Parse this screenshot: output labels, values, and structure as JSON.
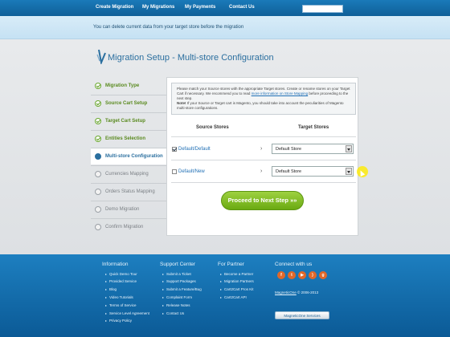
{
  "nav": {
    "items": [
      "Create Migration",
      "My Migrations",
      "My Payments",
      "Contact Us"
    ],
    "search_placeholder": ""
  },
  "notice": "You can delete current data from your target store before the migration",
  "page_title": "Migration Setup - Multi-store Configuration",
  "steps": [
    {
      "label": "Migration Type",
      "state": "done"
    },
    {
      "label": "Source Cart Setup",
      "state": "done"
    },
    {
      "label": "Target Cart Setup",
      "state": "done"
    },
    {
      "label": "Entities Selection",
      "state": "done"
    },
    {
      "label": "Multi-store Configuration",
      "state": "active"
    },
    {
      "label": "Currencies Mapping",
      "state": "pending"
    },
    {
      "label": "Orders Status Mapping",
      "state": "pending"
    },
    {
      "label": "Demo Migration",
      "state": "pending"
    },
    {
      "label": "Confirm Migration",
      "state": "pending"
    }
  ],
  "info": {
    "line1_pre": "Please match your Source stores with the appropriate Target stores. Create or rename stores on your Target Cart if necessary. We recommend you to read ",
    "link": "more information on Store Mapping",
    "line1_post": " before proceeding to the next step.",
    "note_label": "Note!",
    "note": " If your Source or Target cart is Magento, you should take into account the peculiarities of Magento multi-store configurations."
  },
  "table": {
    "source_header": "Source Stores",
    "target_header": "Target Stores",
    "rows": [
      {
        "source": "Default/Default",
        "checked": true,
        "target": "Default Store"
      },
      {
        "source": "Default/New",
        "checked": false,
        "target": "Default Store"
      }
    ]
  },
  "proceed_label": "Proceed to Next Step »»",
  "footer": {
    "information": {
      "title": "Information",
      "links": [
        "Quick Demo Tour",
        "Provided Service",
        "Blog",
        "Video Tutorials",
        "Terms of Service",
        "Service Level Agreement",
        "Privacy Policy"
      ]
    },
    "support": {
      "title": "Support Center",
      "links": [
        "Submit a Ticket",
        "Support Packages",
        "Submit a Feature/Bug",
        "Complaint Form",
        "Release Notes",
        "Contact Us"
      ]
    },
    "partner": {
      "title": "For Partner",
      "links": [
        "Become a Partner",
        "Migration Partners",
        "Cart2Cart Pros Kit",
        "Cart2Cart API"
      ]
    },
    "connect": {
      "title": "Connect with us",
      "icons": [
        "facebook-icon",
        "twitter-icon",
        "youtube-icon",
        "rss-icon",
        "google-plus-icon"
      ],
      "brand": "MagneticOne",
      "copyright": " © 2006-2013",
      "services_button": "MagneticOne Services"
    }
  },
  "colors": {
    "nav_blue": "#0f5f98",
    "accent_green": "#6aaa12",
    "done_green": "#5a8a1f",
    "title_blue": "#2b6f9f",
    "social_orange": "#e0682a"
  }
}
